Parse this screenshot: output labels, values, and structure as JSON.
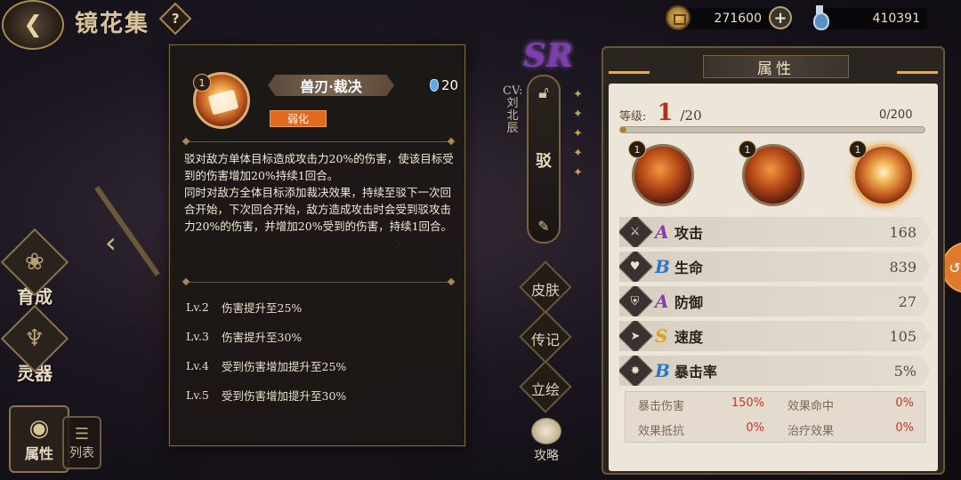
{
  "header": {
    "title": "镜花集",
    "help": "?",
    "back_icon": "back-arrow-icon"
  },
  "currencies": [
    {
      "name": "coin",
      "value": "271600",
      "icon": "coin-icon"
    },
    {
      "name": "potion",
      "value": "410391",
      "icon": "potion-icon"
    }
  ],
  "nav": {
    "items": [
      {
        "label": "育成",
        "icon": "flower-icon"
      },
      {
        "label": "灵器",
        "icon": "artifact-icon"
      }
    ],
    "attr_label": "属性",
    "list_label": "列表"
  },
  "skill_popup": {
    "level": "1",
    "name": "兽刃·裁决",
    "cost": "20",
    "tag": "弱化",
    "description": [
      "驳对敌方单体目标造成攻击力20%的伤害，使该目标受到的伤害增加20%持续1回合。",
      "同时对敌方全体目标添加裁决效果，持续至驳下一次回合开始，下次回合开始，敌方造成攻击时会受到驳攻击力20%的伤害，并增加20%受到的伤害，持续1回合。"
    ],
    "upgrades": [
      {
        "lv": "Lv.2",
        "text": "伤害提升至25%"
      },
      {
        "lv": "Lv.3",
        "text": "伤害提升至30%"
      },
      {
        "lv": "Lv.4",
        "text": "受到伤害增加提升至25%"
      },
      {
        "lv": "Lv.5",
        "text": "受到伤害增加提升至30%"
      }
    ]
  },
  "character": {
    "rarity": "SR",
    "cv_label": "CV:",
    "cv_name": "刘北辰",
    "name": "驳",
    "buttons": [
      "皮肤",
      "传记",
      "立绘"
    ],
    "guide_label": "攻略"
  },
  "attributes": {
    "title": "属性",
    "level_label": "等级:",
    "level": "1",
    "level_max": "/20",
    "exp": "0/200",
    "exp_fraction": 0.0,
    "slot_levels": [
      "1",
      "1",
      "1"
    ],
    "stats": [
      {
        "grade": "A",
        "grade_color": "#8a3ab0",
        "name": "攻击",
        "value": "168",
        "icon": "attack-icon"
      },
      {
        "grade": "B",
        "grade_color": "#2a78c8",
        "name": "生命",
        "value": "839",
        "icon": "heart-icon"
      },
      {
        "grade": "A",
        "grade_color": "#8a3ab0",
        "name": "防御",
        "value": "27",
        "icon": "shield-icon"
      },
      {
        "grade": "S",
        "grade_color": "#e0a020",
        "name": "速度",
        "value": "105",
        "icon": "speed-icon"
      },
      {
        "grade": "B",
        "grade_color": "#2a78c8",
        "name": "暴击率",
        "value": "5%",
        "icon": "crit-icon"
      }
    ],
    "sub_stats": [
      {
        "k": "暴击伤害",
        "v": "150%"
      },
      {
        "k": "效果命中",
        "v": "0%"
      },
      {
        "k": "效果抵抗",
        "v": "0%"
      },
      {
        "k": "治疗效果",
        "v": "0%"
      }
    ]
  }
}
